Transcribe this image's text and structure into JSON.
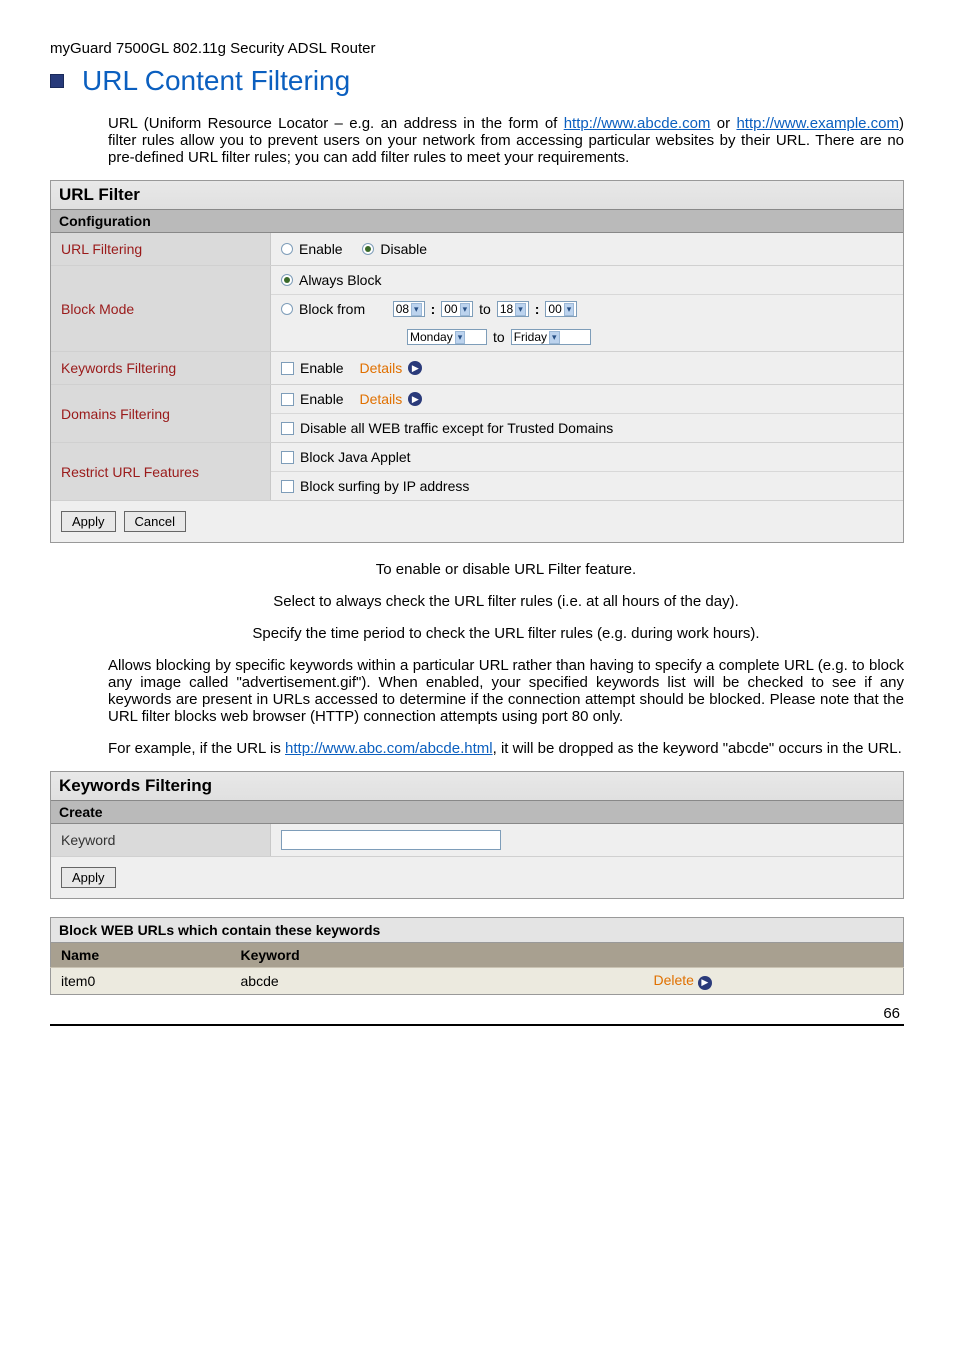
{
  "breadcrumb": "myGuard 7500GL 802.11g Security ADSL Router",
  "page_title": "URL Content Filtering",
  "intro": {
    "p1a": "URL (Uniform Resource Locator – e.g. an address in the form of ",
    "link1": "http://www.abcde.com",
    "p1b": " or ",
    "link2": "http://www.example.com",
    "p1c": ") filter rules allow you to prevent users on your network from accessing particular websites by their URL. There are no pre-defined URL filter rules; you can add filter rules to meet your requirements."
  },
  "url_filter": {
    "panel_title": "URL Filter",
    "section_title": "Configuration",
    "rows": {
      "url_filtering": {
        "label": "URL Filtering",
        "enable": "Enable",
        "disable": "Disable"
      },
      "block_mode": {
        "label": "Block Mode",
        "always": "Always Block",
        "from": "Block from",
        "h1": "08",
        "m1": "00",
        "to1": "to",
        "h2": "18",
        "m2": "00",
        "day1": "Monday",
        "to2": "to",
        "day2": "Friday"
      },
      "keywords": {
        "label": "Keywords Filtering",
        "enable": "Enable",
        "details": "Details"
      },
      "domains": {
        "label": "Domains Filtering",
        "enable": "Enable",
        "details": "Details",
        "disable_all": "Disable all WEB traffic except for Trusted Domains"
      },
      "restrict": {
        "label": "Restrict URL Features",
        "java": "Block Java Applet",
        "ip": "Block surfing by IP address"
      }
    },
    "apply": "Apply",
    "cancel": "Cancel"
  },
  "defs": {
    "url_filtering": "To enable or disable URL Filter feature.",
    "always_block": "Select to always check the URL filter rules (i.e. at all hours of the day).",
    "block_from": "Specify the time period to check the URL filter rules (e.g. during work hours).",
    "keywords_a": "Allows blocking by specific keywords within a particular URL rather than having to specify a complete URL (e.g. to block any image called \"advertisement.gif\"). When enabled, your specified keywords list will be checked to see if any keywords are present in URLs accessed to determine if the connection attempt should be blocked. Please note that the URL filter blocks web browser (HTTP) connection attempts using port 80 only.",
    "example_a": "For example, if the URL is ",
    "example_link": "http://www.abc.com/abcde.html",
    "example_b": ", it will be dropped as the keyword \"abcde\" occurs in the URL."
  },
  "kw_panel": {
    "title": "Keywords Filtering",
    "create": "Create",
    "keyword_label": "Keyword",
    "apply": "Apply",
    "block_title": "Block WEB URLs which contain these keywords",
    "col_name": "Name",
    "col_keyword": "Keyword",
    "row0_name": "item0",
    "row0_kw": "abcde",
    "delete": "Delete"
  },
  "page_number": "66"
}
